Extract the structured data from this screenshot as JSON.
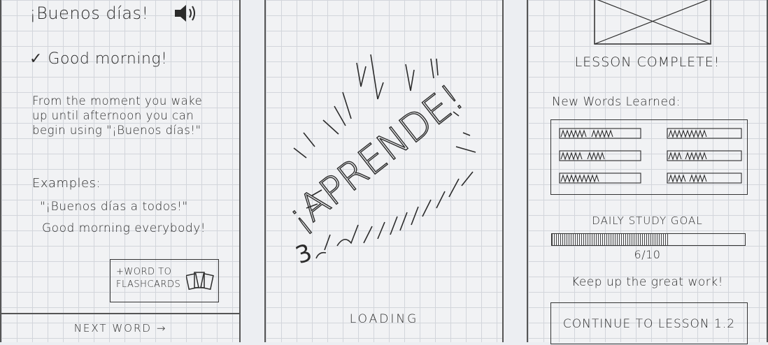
{
  "panel1": {
    "greeting": "¡Buenos días!",
    "speaker_icon": "speaker-icon",
    "translation": "✓ Good morning!",
    "explanation": "From the moment you wake up until afternoon you can begin using \"¡Buenos días!\"",
    "examples_label": "Examples:",
    "example_spanish": "\"¡Buenos días a todos!\"",
    "example_english": "Good morning everybody!",
    "flashcard_button": "+WORD TO FLASHCARDS",
    "flashcard_icon": "flashcards-icon",
    "next_button": "NEXT WORD →"
  },
  "panel2": {
    "splash_text": "¡APRENDE!",
    "loading_label": "LOADING"
  },
  "panel3": {
    "image_placeholder_icon": "image-placeholder-icon",
    "lesson_complete": "LESSON COMPLETE!",
    "new_words_label": "New Words Learned:",
    "goal_title": "DAILY STUDY GOAL",
    "goal_progress": 0.6,
    "goal_count": "6/10",
    "encouragement": "Keep up the great work!",
    "continue_button": "CONTINUE TO LESSON 1.2"
  }
}
